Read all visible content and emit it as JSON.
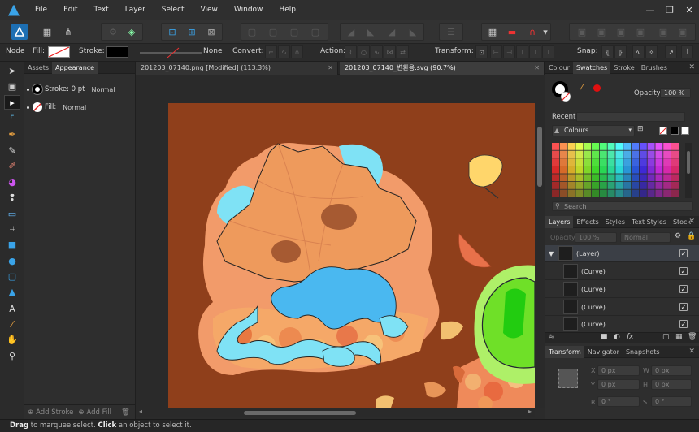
{
  "menu": {
    "items": [
      "File",
      "Edit",
      "Text",
      "Layer",
      "Select",
      "View",
      "Window",
      "Help"
    ]
  },
  "window_controls": {
    "minimize": "—",
    "restore": "❐",
    "close": "✕"
  },
  "context_toolbar": {
    "node_label": "Node",
    "fill_label": "Fill:",
    "stroke_label": "Stroke:",
    "stroke_none": "None",
    "convert_label": "Convert:",
    "action_label": "Action:",
    "transform_label": "Transform:",
    "snap_label": "Snap:"
  },
  "left_panel": {
    "tabs": [
      "Assets",
      "Appearance"
    ],
    "stroke_row": {
      "label": "Stroke: 0 pt",
      "mode": "Normal"
    },
    "fill_row": {
      "label": "Fill:",
      "mode": "Normal"
    },
    "add_stroke": "Add Stroke",
    "add_fill": "Add Fill"
  },
  "documents": {
    "tabs": [
      {
        "title": "201203_07140.png [Modified] (113.3%)",
        "active": false
      },
      {
        "title": "201203_07140_변환용.svg (90.7%)",
        "active": true
      }
    ]
  },
  "colour_panel": {
    "tabs": [
      "Colour",
      "Swatches",
      "Stroke",
      "Brushes"
    ],
    "opacity_label": "Opacity:",
    "opacity_value": "100 %",
    "recent_label": "Recent:",
    "palette_name": "Colours",
    "search_placeholder": "Search"
  },
  "layers_panel": {
    "tabs": [
      "Layers",
      "Effects",
      "Styles",
      "Text Styles",
      "Stock"
    ],
    "opacity_label": "Opacity",
    "opacity_value": "100 %",
    "blend_mode": "Normal",
    "rows": [
      {
        "name": "(Layer)",
        "type": "layer",
        "checked": true
      },
      {
        "name": "(Curve)",
        "type": "curve",
        "checked": true
      },
      {
        "name": "(Curve)",
        "type": "curve",
        "checked": true
      },
      {
        "name": "(Curve)",
        "type": "curve",
        "checked": true
      },
      {
        "name": "(Curve)",
        "type": "curve",
        "checked": true
      }
    ]
  },
  "transform_panel": {
    "tabs": [
      "Transform",
      "Navigator",
      "Snapshots"
    ],
    "x_label": "X",
    "y_label": "Y",
    "w_label": "W",
    "h_label": "H",
    "r_label": "R",
    "s_label": "S",
    "x": "0 px",
    "y": "0 px",
    "w": "0 px",
    "h": "0 px",
    "r": "0 °",
    "s": "0 °"
  },
  "status": {
    "prefix": "Drag",
    "mid": " to marquee select. ",
    "action": "Click",
    "suffix": " an object to select it."
  },
  "colors": {
    "accent": "#3aa3e8",
    "canvas_bg": "#8f3f1b"
  }
}
